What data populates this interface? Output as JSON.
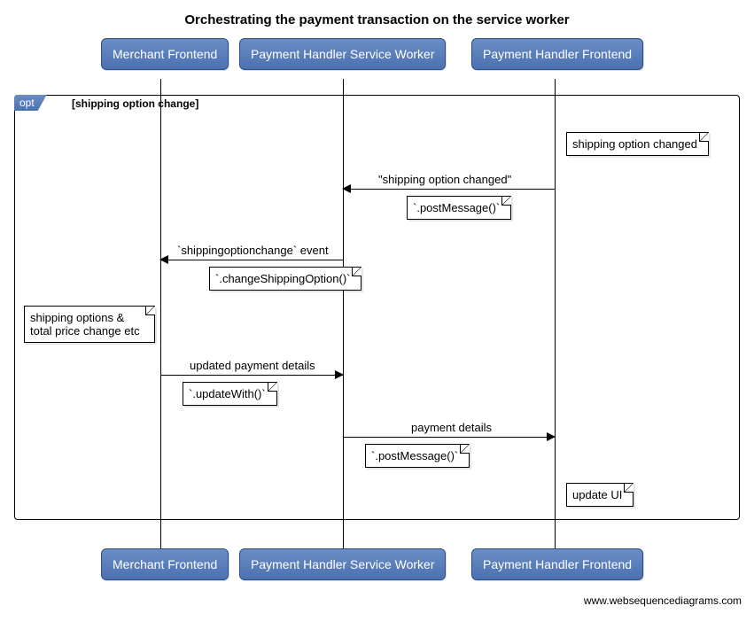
{
  "title": "Orchestrating the payment transaction on the service worker",
  "participants": {
    "merchant": "Merchant Frontend",
    "worker": "Payment Handler Service Worker",
    "frontend": "Payment Handler Frontend"
  },
  "opt": {
    "label": "opt",
    "guard": "[shipping option change]"
  },
  "notes": {
    "n1": "shipping option changed",
    "n2": "`.postMessage()`",
    "n3": "`.changeShippingOption()`",
    "n4_line1": "shipping options &",
    "n4_line2": "total price change etc",
    "n5": "`.updateWith()`",
    "n6": "`.postMessage()`",
    "n7": "update UI"
  },
  "messages": {
    "m1": "\"shipping option changed\"",
    "m2": "`shippingoptionchange` event",
    "m3": "updated payment details",
    "m4": "payment details"
  },
  "watermark": "www.websequencediagrams.com"
}
